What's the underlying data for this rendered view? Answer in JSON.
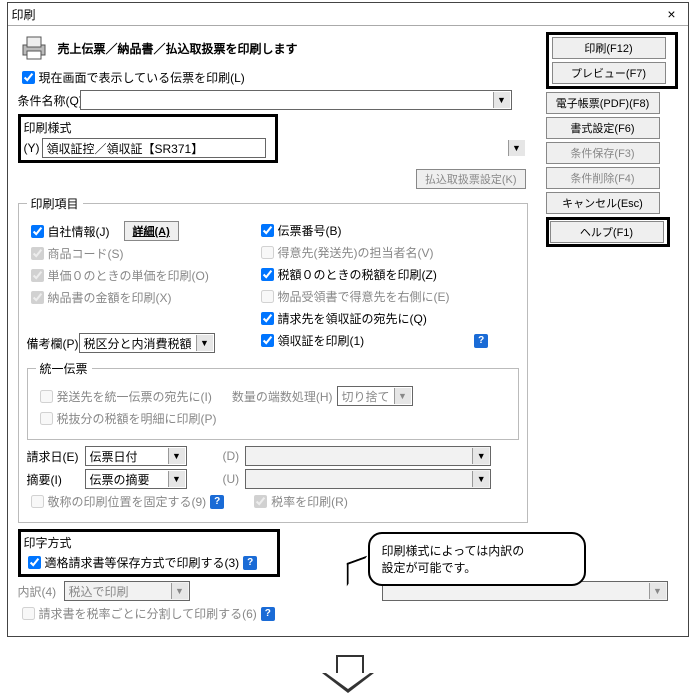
{
  "window": {
    "title": "印刷"
  },
  "header": {
    "description": "売上伝票／納品書／払込取扱票を印刷します"
  },
  "right_buttons": {
    "print": "印刷(F12)",
    "preview": "プレビュー(F7)",
    "epdf": "電子帳票(PDF)(F8)",
    "format": "書式設定(F6)",
    "save_cond": "条件保存(F3)",
    "del_cond": "条件削除(F4)",
    "cancel": "キャンセル(Esc)",
    "help": "ヘルプ(F1)"
  },
  "current_screen": {
    "label": "現在画面で表示している伝票を印刷(L)"
  },
  "cond_name": {
    "label": "条件名称(Q)",
    "value": ""
  },
  "style": {
    "legend": "印刷様式",
    "prefix": "(Y)",
    "value": "領収証控／領収証【SR371】"
  },
  "furikomi_btn": "払込取扱票設定(K)",
  "items": {
    "legend": "印刷項目",
    "own_info": "自社情報(J)",
    "detail_btn": "詳細(A)",
    "slip_no": "伝票番号(B)",
    "product_code": "商品コード(S)",
    "ship_contact": "得意先(発送先)の担当者名(V)",
    "unit0": "単価０のときの単価を印刷(O)",
    "tax0": "税額０のときの税額を印刷(Z)",
    "nouhin_amount": "納品書の金額を印刷(X)",
    "ukesho_right": "物品受領書で得意先を右側に(E)",
    "billto_receipt": "請求先を領収証の宛先に(Q)",
    "memo_label": "備考欄(P)",
    "memo_value": "税区分と内消費税額",
    "print_receipt": "領収証を印刷(1)"
  },
  "touitsu": {
    "legend": "統一伝票",
    "ship_as_addr": "発送先を統一伝票の宛先に(I)",
    "qty_round_label": "数量の端数処理(H)",
    "qty_round_value": "切り捨て",
    "zeinuki_detail": "税抜分の税額を明細に印刷(P)"
  },
  "bill_date": {
    "label": "請求日(E)",
    "value": "伝票日付",
    "d_label": "(D)"
  },
  "tekiyo": {
    "label": "摘要(I)",
    "value": "伝票の摘要",
    "u_label": "(U)"
  },
  "keisho_fix": "敬称の印刷位置を固定する(9)",
  "tax_rate_print": "税率を印刷(R)",
  "inji": {
    "legend": "印字方式",
    "tekikaku": "適格請求書等保存方式で印刷する(3)",
    "uchiwake_label": "内訳(4)",
    "uchiwake_value": "税込で印刷",
    "split_by_rate": "請求書を税率ごとに分割して印刷する(6)"
  },
  "annotation": {
    "line1": "印刷様式によっては内訳の",
    "line2": "設定が可能です。"
  }
}
